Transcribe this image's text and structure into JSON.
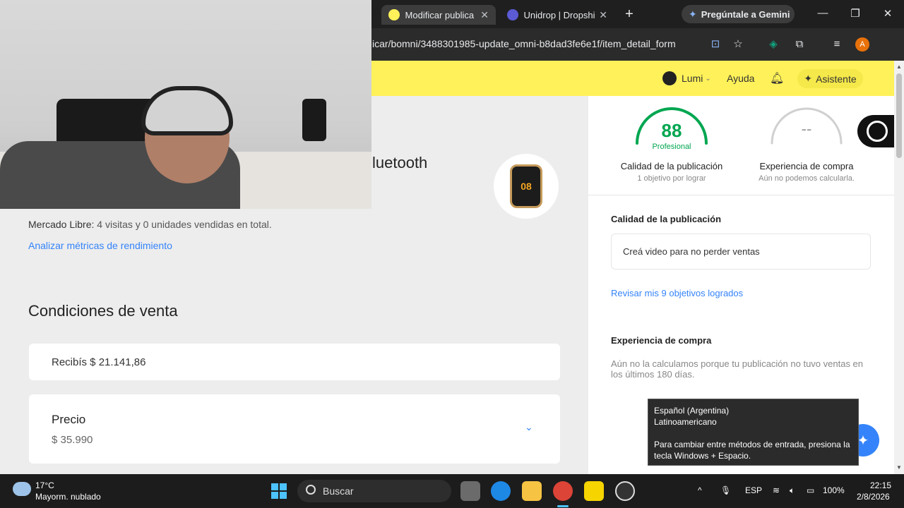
{
  "browser": {
    "tabs": [
      {
        "title": "Modificar publica",
        "active": true
      },
      {
        "title": "Unidrop | Dropshi",
        "active": false
      }
    ],
    "gemini_label": "Pregúntale a Gemini",
    "url": "icar/bomni/3488301985-update_omni-b8dad3fe6e1f/item_detail_form",
    "profile_initial": "A"
  },
  "header": {
    "user": "Lumi",
    "help": "Ayuda",
    "assistant": "Asistente"
  },
  "left": {
    "title_fragment": "luetooth",
    "watch_display": "08",
    "stats_prefix": "Mercado Libre:",
    "stats_text": "4 visitas y 0 unidades vendidas en total.",
    "metrics_link": "Analizar métricas de rendimiento",
    "section_title": "Condiciones de venta",
    "recibis": "Recibís $ 21.141,86",
    "price_label": "Precio",
    "price_value": "$ 35.990"
  },
  "right": {
    "quality": {
      "score": "88",
      "level": "Profesional",
      "title": "Calidad de la publicación",
      "subtitle": "1 objetivo por lograr",
      "progress": 0.88
    },
    "experience": {
      "score": "--",
      "title": "Experiencia de compra",
      "subtitle": "Aún no podemos calcularla."
    },
    "quality_heading": "Calidad de la publicación",
    "objective": "Creá video para no perder ventas",
    "achieved_link": "Revisar mis 9 objetivos logrados",
    "experience_heading": "Experiencia de compra",
    "experience_text": "Aún no la calculamos porque tu publicación no tuvo ventas en los últimos 180 días."
  },
  "tooltip": {
    "line1": "Español (Argentina)",
    "line2": "Latinoamericano",
    "line3": "Para cambiar entre métodos de entrada, presiona la tecla Windows + Espacio."
  },
  "taskbar": {
    "temperature": "17°C",
    "condition": "Mayorm. nublado",
    "search_placeholder": "Buscar",
    "language": "ESP",
    "battery": "100%",
    "time": "22:15",
    "date": "2/8/2026"
  },
  "colors": {
    "ml_yellow": "#fff159",
    "ml_blue": "#3483fa",
    "ml_green": "#00a650"
  }
}
